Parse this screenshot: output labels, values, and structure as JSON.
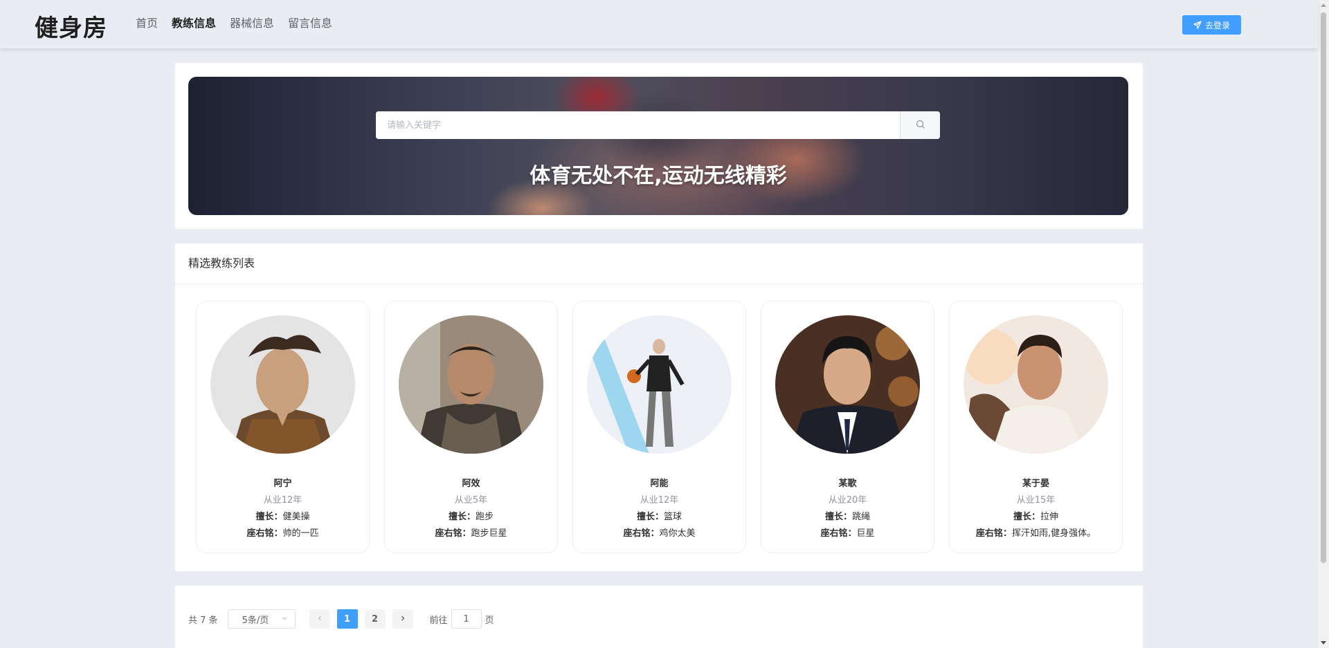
{
  "header": {
    "brand": "健身房",
    "nav": [
      {
        "label": "首页",
        "active": false
      },
      {
        "label": "教练信息",
        "active": true
      },
      {
        "label": "器械信息",
        "active": false
      },
      {
        "label": "留言信息",
        "active": false
      }
    ],
    "login_label": "去登录",
    "login_icon": "send-icon"
  },
  "banner": {
    "search_placeholder": "请输入关键字",
    "search_value": "",
    "slogan": "体育无处不在,运动无线精彩"
  },
  "coach_section": {
    "title": "精选教练列表",
    "skill_label": "擅长：",
    "motto_label": "座右铭：",
    "coaches": [
      {
        "name": "阿宁",
        "years": "从业12年",
        "skill": "健美操",
        "motto": "帅的一匹"
      },
      {
        "name": "阿效",
        "years": "从业5年",
        "skill": "跑步",
        "motto": "跑步巨星"
      },
      {
        "name": "阿能",
        "years": "从业12年",
        "skill": "篮球",
        "motto": "鸡你太美"
      },
      {
        "name": "某歌",
        "years": "从业20年",
        "skill": "跳绳",
        "motto": "巨星"
      },
      {
        "name": "某于晏",
        "years": "从业15年",
        "skill": "拉伸",
        "motto": "挥汗如雨,健身强体。"
      }
    ]
  },
  "pagination": {
    "total_label": "共 7 条",
    "page_size": "5条/页",
    "pages": [
      "1",
      "2"
    ],
    "current_page": "1",
    "goto_prefix": "前往",
    "goto_value": "1",
    "goto_suffix": "页"
  },
  "colors": {
    "accent": "#409eff",
    "page_bg": "#e9ecf3"
  }
}
